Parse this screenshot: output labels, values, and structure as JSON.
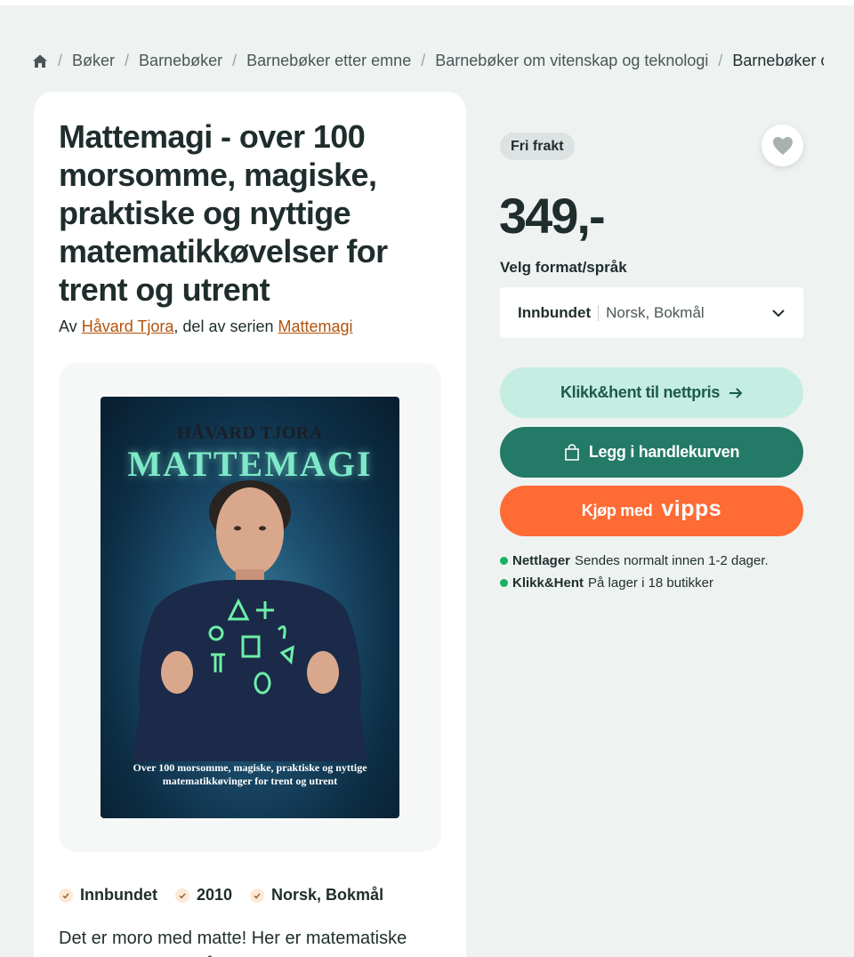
{
  "breadcrumb": {
    "items": [
      "Bøker",
      "Barnebøker",
      "Barnebøker etter emne",
      "Barnebøker om vitenskap og teknologi",
      "Barnebøker om"
    ]
  },
  "product": {
    "title": "Mattemagi - over 100 morsomme, magiske, praktiske og nyttige matematikkøvelser for trent og utrent",
    "by_prefix": "Av",
    "author": "Håvard Tjora",
    "series_prefix": ", del av serien",
    "series": "Mattemagi",
    "cover": {
      "author": "HÅVARD TJORA",
      "brand": "MATTEMAGI",
      "subtitle": "Over 100 morsomme, magiske, praktiske og nyttige matematikkøvinger for trent og utrent"
    },
    "features": [
      "Innbundet",
      "2010",
      "Norsk, Bokmål"
    ],
    "description": "Det er moro med matte! Her er matematiske dilemmaer, mattegåter, mattenøtter og"
  },
  "purchase": {
    "badge": "Fri frakt",
    "price": "349,-",
    "format_label": "Velg format/språk",
    "selected_format": "Innbundet",
    "selected_language": "Norsk, Bokmål",
    "click_collect_button": "Klikk&hent til nettpris",
    "cart_button": "Legg i handlekurven",
    "vipps_prefix": "Kjøp med",
    "vipps_logo": "vipps"
  },
  "stock": [
    {
      "label": "Nettlager",
      "text": "Sendes normalt innen 1-2 dager."
    },
    {
      "label": "Klikk&Hent",
      "text": "På lager i 18 butikker"
    }
  ],
  "colors": {
    "accent_green": "#237a66",
    "light_green": "#c5ede2",
    "vipps_orange": "#ff6b35",
    "link_orange": "#b3520b",
    "stock_dot": "#1bb165"
  },
  "icons": [
    "home-icon",
    "heart-icon",
    "chevron-down-icon",
    "arrow-right-icon",
    "shopping-bag-icon",
    "check-icon"
  ]
}
